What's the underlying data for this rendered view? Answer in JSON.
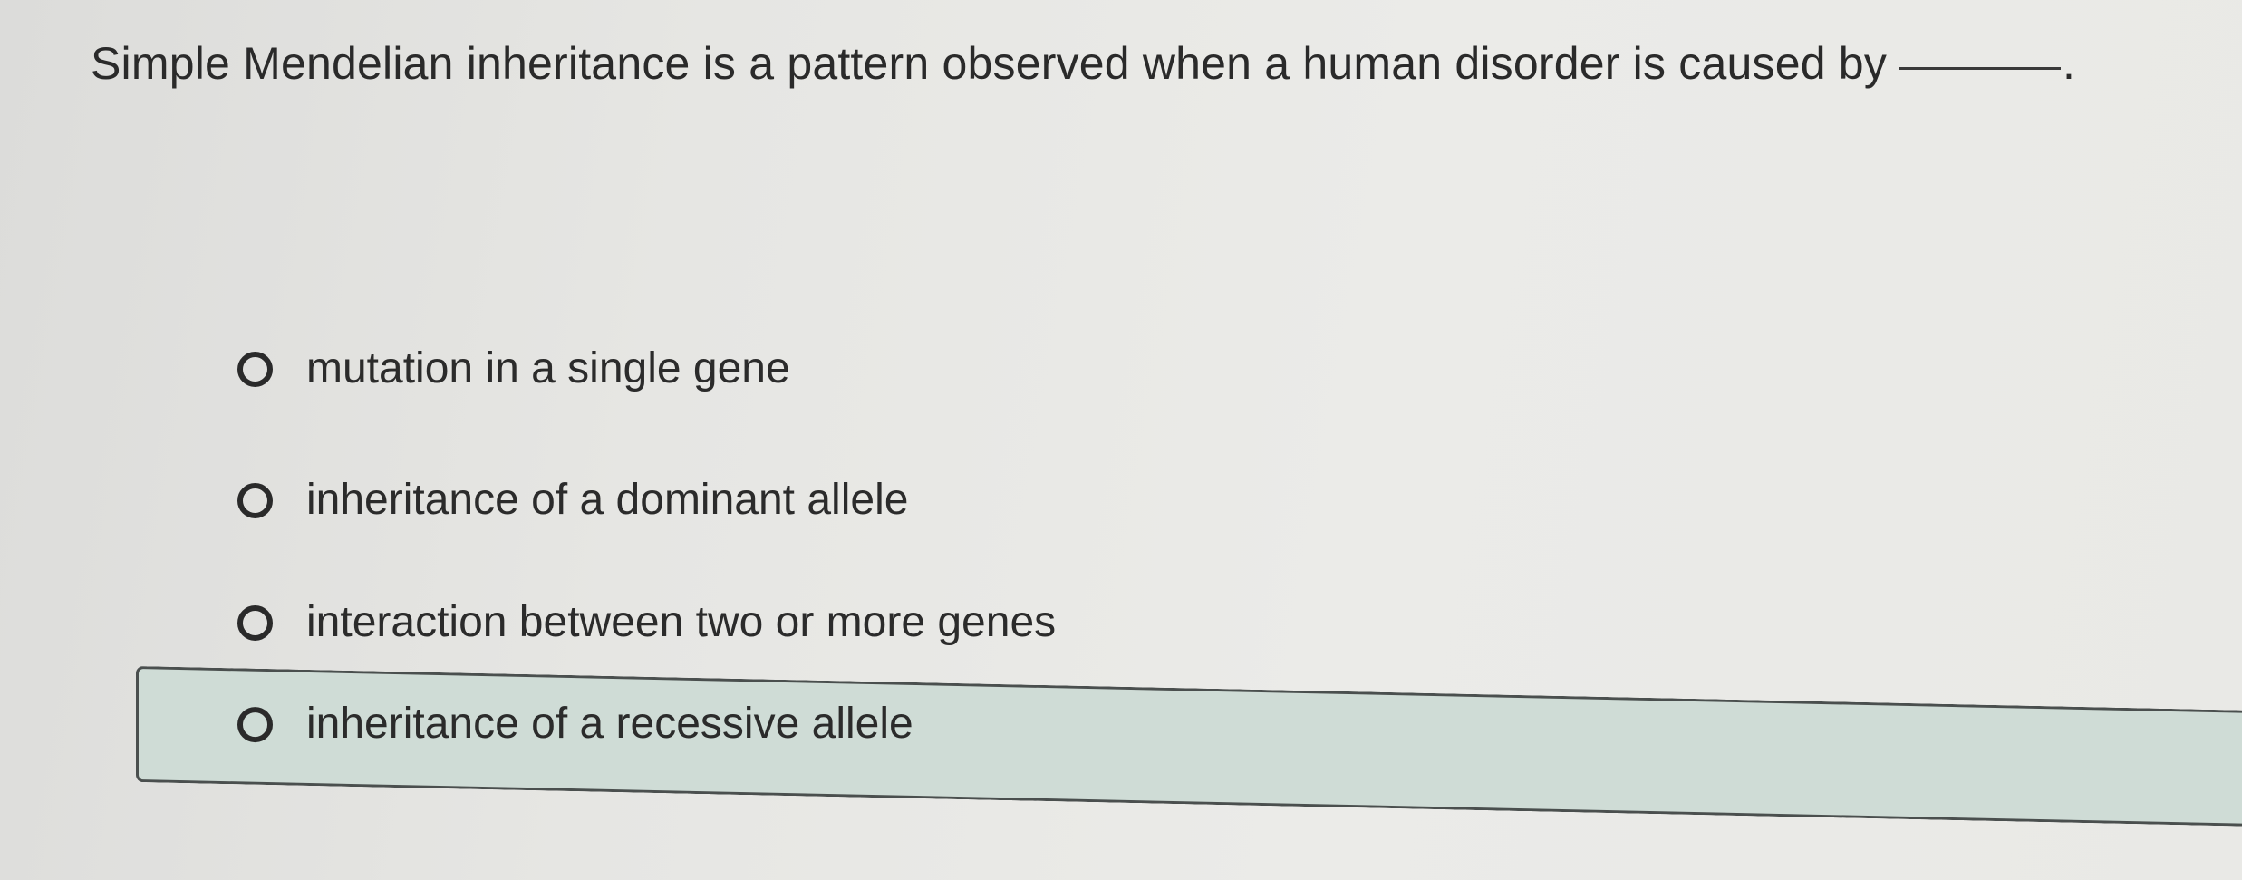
{
  "question": {
    "text": "Simple Mendelian inheritance is a pattern observed when a human disorder is caused by",
    "trailing_punctuation": "."
  },
  "options": [
    {
      "label": "mutation in a single gene",
      "selected": false,
      "highlighted": false
    },
    {
      "label": "inheritance of a dominant allele",
      "selected": false,
      "highlighted": false
    },
    {
      "label": "interaction between two or more genes",
      "selected": false,
      "highlighted": false
    },
    {
      "label": "inheritance of a recessive allele",
      "selected": false,
      "highlighted": true
    }
  ],
  "colors": {
    "highlight_background": "#cfdcd6",
    "highlight_border": "#4a4f4e",
    "text": "#2a2a2a"
  }
}
